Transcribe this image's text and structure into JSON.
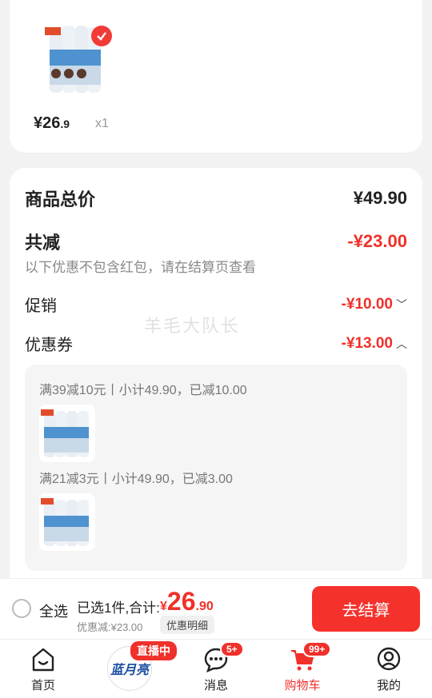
{
  "product": {
    "price_int": "¥26",
    "price_dec": ".9",
    "qty": "x1"
  },
  "summary": {
    "total_label": "商品总价",
    "total_value": "¥49.90",
    "discount_label": "共减",
    "discount_value": "-¥23.00",
    "note": "以下优惠不包含红包，请在结算页查看",
    "promo_label": "促销",
    "promo_value": "-¥10.00",
    "coupon_label": "优惠券",
    "coupon_value": "-¥13.00",
    "watermark": "羊毛大队长"
  },
  "coupons": [
    {
      "text": "满39减10元丨小计49.90，已减10.00"
    },
    {
      "text": "满21减3元丨小计49.90，已减3.00"
    }
  ],
  "checkout": {
    "select_all": "全选",
    "selected_text": "已选1件,合计:",
    "total_sym": "¥",
    "total_int": "26",
    "total_dec": ".90",
    "discount_note": "优惠减:¥23.00",
    "detail_btn": "优惠明细",
    "checkout_btn": "去结算"
  },
  "tabbar": {
    "home": "首页",
    "live_badge": "直播中",
    "brand_logo": "蓝月亮",
    "messages": "消息",
    "messages_badge": "5+",
    "cart": "购物车",
    "cart_badge": "99+",
    "mine": "我的"
  },
  "colors": {
    "accent": "#f0302a",
    "background": "#f2f2f2"
  }
}
